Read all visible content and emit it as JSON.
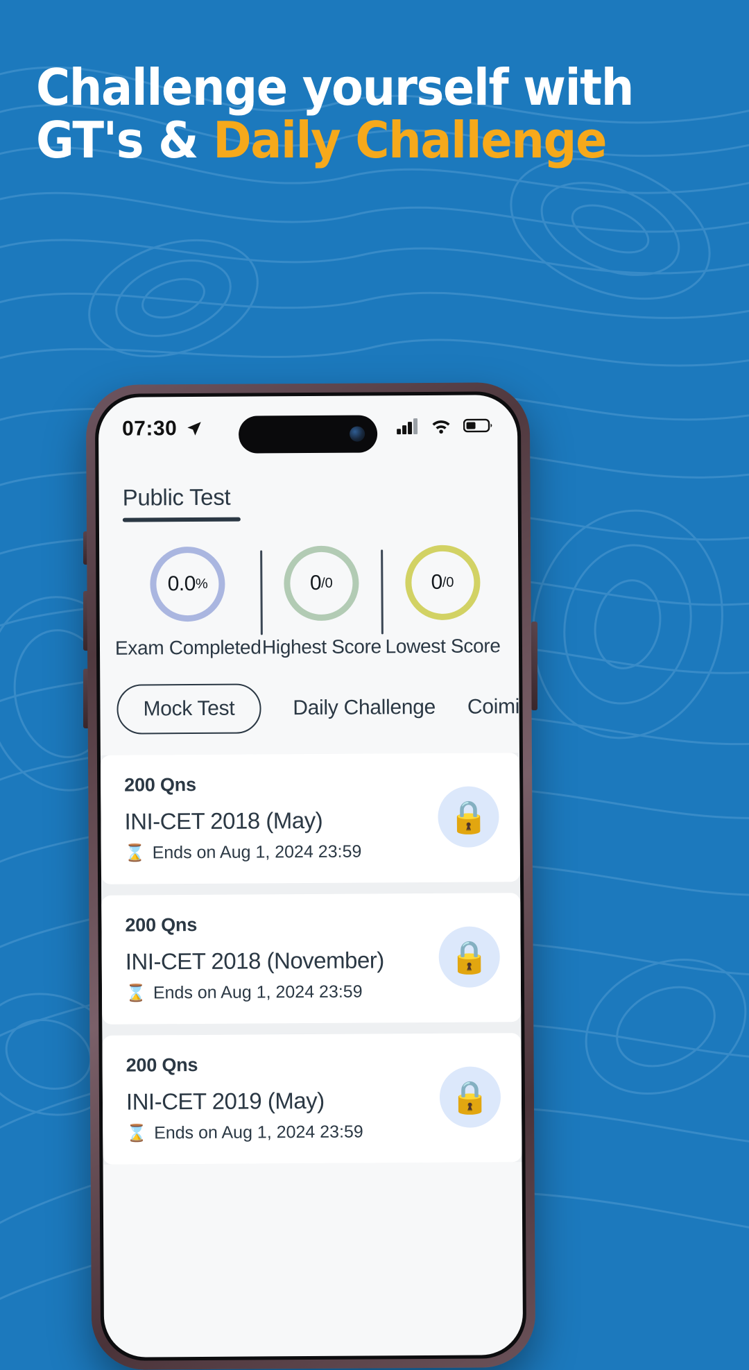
{
  "promo": {
    "headline_line1": "Challenge yourself with",
    "headline_line2_prefix": "GT's & ",
    "headline_line2_accent": "Daily Challenge",
    "bg_color": "#1c79bd",
    "accent_color": "#f6a91b"
  },
  "status_bar": {
    "time": "07:30",
    "location_icon": "location-arrow-icon",
    "signal_icon": "cellular-signal-icon",
    "wifi_icon": "wifi-icon",
    "battery_icon": "battery-icon"
  },
  "header": {
    "title": "Public Test"
  },
  "stats": [
    {
      "value": "0.0",
      "unit": "%",
      "label": "Exam Completed",
      "ring_color": "#aab6e0"
    },
    {
      "value": "0",
      "unit": "/0",
      "label": "Highest Score",
      "ring_color": "#b2cbb4"
    },
    {
      "value": "0",
      "unit": "/0",
      "label": "Lowest Score",
      "ring_color": "#d2d264"
    }
  ],
  "tabs": [
    {
      "label": "Mock Test",
      "active": true
    },
    {
      "label": "Daily Challenge",
      "active": false
    },
    {
      "label": "Coiming Soon",
      "active": false
    }
  ],
  "tests": [
    {
      "questions": "200 Qns",
      "title": "INI-CET 2018 (May)",
      "ends": "Ends on Aug 1, 2024 23:59",
      "lock_icon": "lock-icon"
    },
    {
      "questions": "200 Qns",
      "title": "INI-CET 2018 (November)",
      "ends": "Ends on Aug 1, 2024 23:59",
      "lock_icon": "lock-icon"
    },
    {
      "questions": "200 Qns",
      "title": "INI-CET 2019 (May)",
      "ends": "Ends on Aug 1, 2024 23:59",
      "lock_icon": "lock-icon"
    }
  ]
}
